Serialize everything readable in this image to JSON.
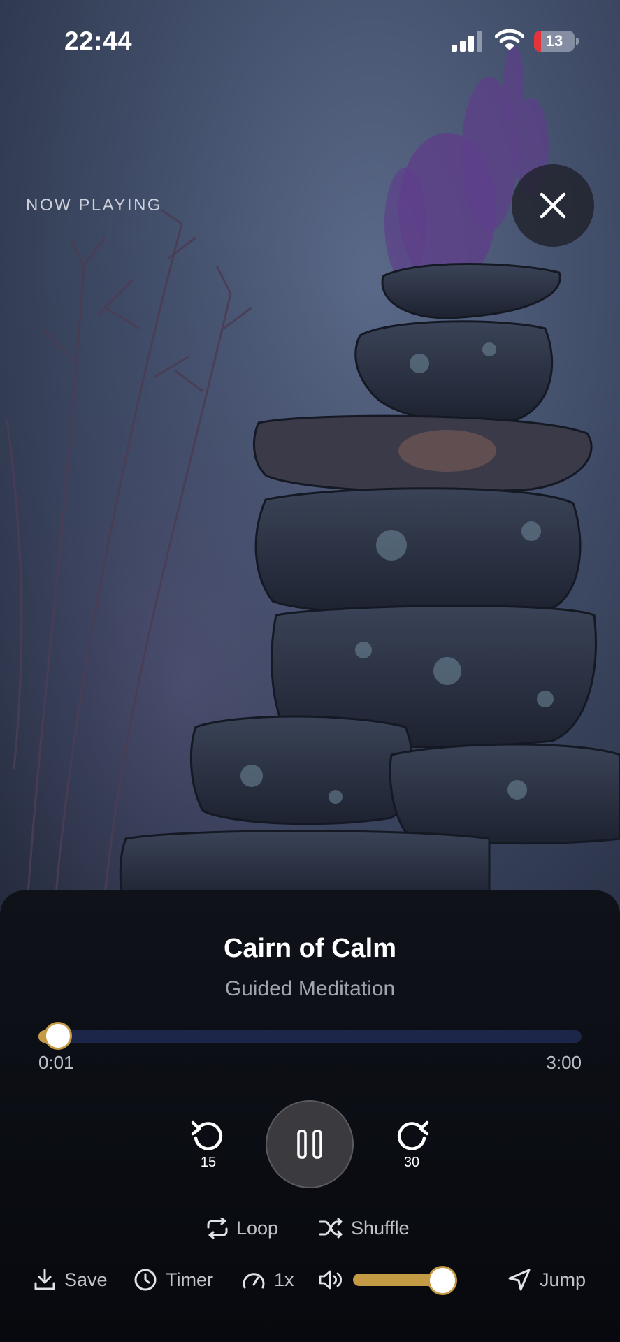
{
  "status_bar": {
    "time": "22:44",
    "battery_level": "13",
    "battery_low_color": "#e5333a",
    "signal_icon": "cellular-signal-icon",
    "wifi_icon": "wifi-icon"
  },
  "header": {
    "now_playing_label": "NOW PLAYING",
    "close_icon": "close-icon"
  },
  "artwork": {
    "subject": "stacked-stones-cairn-with-lavender"
  },
  "track": {
    "title": "Cairn of Calm",
    "subtitle": "Guided Meditation"
  },
  "progress": {
    "elapsed": "0:01",
    "total": "3:00",
    "fraction": 0.006
  },
  "controls": {
    "skip_back_label": "15",
    "skip_forward_label": "30",
    "pause_icon": "pause-icon"
  },
  "modes": {
    "loop_label": "Loop",
    "shuffle_label": "Shuffle"
  },
  "bottom_bar": {
    "save_label": "Save",
    "timer_label": "Timer",
    "speed_label": "1x",
    "jump_label": "Jump",
    "volume_fraction": 0.8
  },
  "colors": {
    "accent": "#c49a45",
    "progress_track": "#1c2648",
    "panel": "#0b0e14"
  }
}
